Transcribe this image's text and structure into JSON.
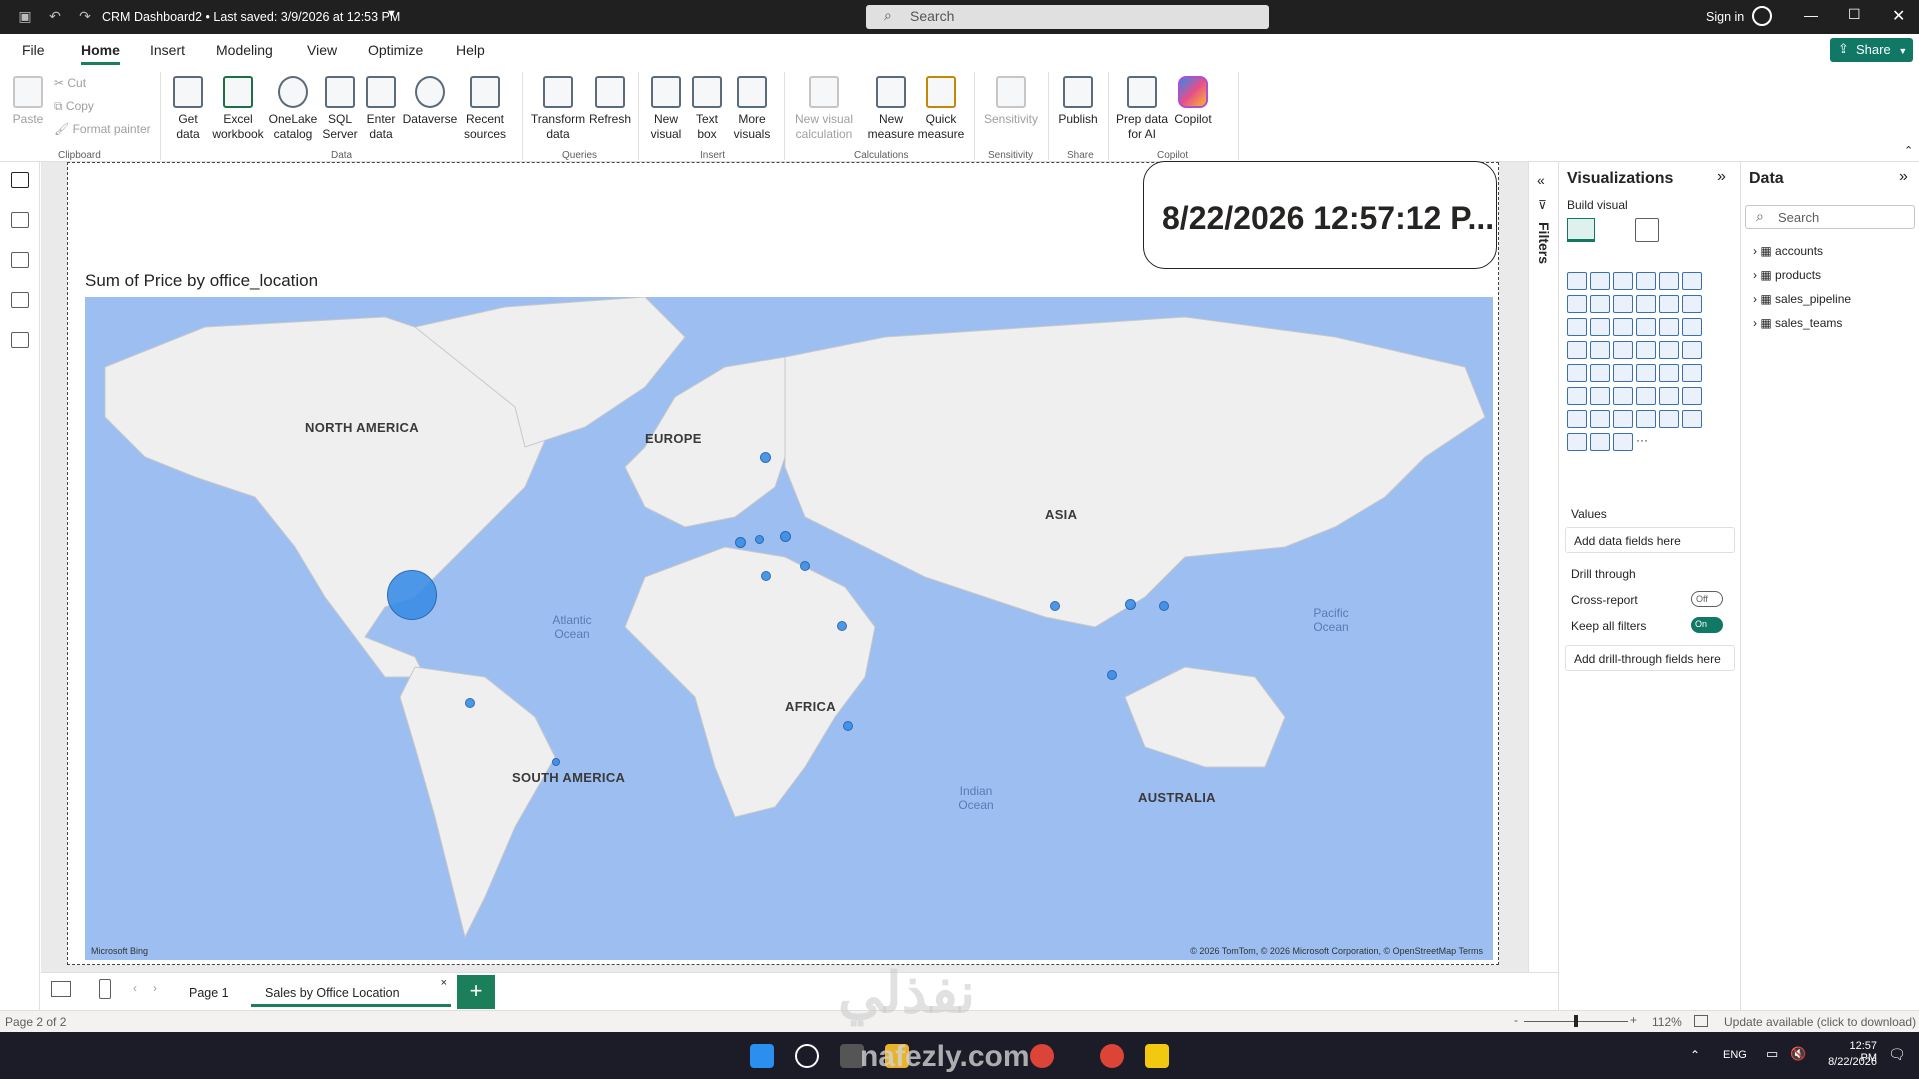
{
  "titlebar": {
    "title": "CRM Dashboard2 • Last saved: 3/9/2026 at 12:53 PM",
    "search_placeholder": "Search",
    "sign_in": "Sign in"
  },
  "menu": {
    "items": [
      "File",
      "Home",
      "Insert",
      "Modeling",
      "View",
      "Optimize",
      "Help"
    ],
    "active": "Home",
    "share_label": "Share"
  },
  "ribbon": {
    "clipboard": {
      "paste": "Paste",
      "cut": "Cut",
      "copy": "Copy",
      "format_painter": "Format painter",
      "group": "Clipboard"
    },
    "data": {
      "get_data": "Get data",
      "excel": "Excel workbook",
      "onelake": "OneLake catalog",
      "sql": "SQL Server",
      "enter": "Enter data",
      "dataverse": "Dataverse",
      "recent": "Recent sources",
      "group": "Data"
    },
    "queries": {
      "transform": "Transform data",
      "refresh": "Refresh",
      "group": "Queries"
    },
    "insert": {
      "new_visual": "New visual",
      "text_box": "Text box",
      "more_visuals": "More visuals",
      "group": "Insert"
    },
    "calculations": {
      "new_visual_calc": "New visual calculation",
      "new_measure": "New measure",
      "quick_measure": "Quick measure",
      "group": "Calculations"
    },
    "sensitivity": {
      "label": "Sensitivity",
      "group": "Sensitivity"
    },
    "share": {
      "publish": "Publish",
      "group": "Share"
    },
    "copilot": {
      "prep": "Prep data for AI",
      "copilot": "Copilot",
      "group": "Copilot"
    }
  },
  "report": {
    "date_card": "8/22/2026 12:57:12 P...",
    "map_title": "Sum of Price by office_location",
    "continents": [
      "NORTH AMERICA",
      "EUROPE",
      "ASIA",
      "AFRICA",
      "SOUTH AMERICA",
      "AUSTRALIA"
    ],
    "oceans": [
      "Atlantic Ocean",
      "Pacific Ocean",
      "Indian Ocean"
    ],
    "bing_logo": "Microsoft Bing",
    "attribution": "© 2026 TomTom, © 2026 Microsoft Corporation, © OpenStreetMap  Terms"
  },
  "filters": {
    "label": "Filters"
  },
  "visualizations": {
    "title": "Visualizations",
    "build_visual": "Build visual",
    "values_label": "Values",
    "values_well": "Add data fields here",
    "drill_through": "Drill through",
    "cross_report": "Cross-report",
    "cross_report_state": "Off",
    "keep_filters": "Keep all filters",
    "keep_filters_state": "On",
    "drill_well": "Add drill-through fields here"
  },
  "data_pane": {
    "title": "Data",
    "search_placeholder": "Search",
    "tables": [
      "accounts",
      "products",
      "sales_pipeline",
      "sales_teams"
    ]
  },
  "tabs": {
    "pages": [
      "Page 1",
      "Sales by Office Location"
    ],
    "active": "Sales by Office Location"
  },
  "status": {
    "page_info": "Page 2 of 2",
    "zoom": "112%",
    "update": "Update available (click to download)"
  },
  "taskbar": {
    "lang": "ENG",
    "time": "12:57 PM",
    "date": "8/22/2026"
  },
  "watermark": {
    "arabic": "نفذلي",
    "latin": "nafezly.com"
  },
  "colors": {
    "accent": "#1a7f5a",
    "map_bg": "#9cbef0",
    "bubble": "#3b8ee8",
    "titlebar": "#202020"
  }
}
